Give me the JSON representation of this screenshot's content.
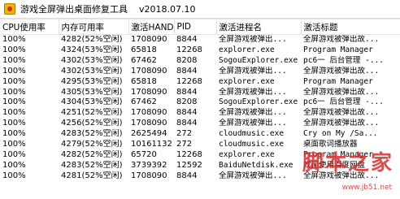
{
  "window": {
    "title": "游戏全屏弹出桌面修复工具",
    "version": "v2018.07.10"
  },
  "table": {
    "columns": [
      "CPU使用率",
      "内存可用率",
      "激活HAND",
      "PID",
      "激活进程名",
      "激活标题"
    ],
    "rows": [
      [
        "100%",
        "4282(52%空闲)",
        "1708090",
        "8844",
        "全屏游戏被弹出...",
        "全屏游戏被弹出故..."
      ],
      [
        "100%",
        "4324(53%空闲)",
        "65818",
        "12268",
        "explorer.exe",
        "Program Manager"
      ],
      [
        "100%",
        "4302(53%空闲)",
        "67462",
        "8208",
        "SogouExplorer.exe",
        "pc6一 后台管理 -..."
      ],
      [
        "100%",
        "4302(53%空闲)",
        "1708090",
        "8844",
        "全屏游戏被弹出...",
        "全屏游戏被弹出故..."
      ],
      [
        "100%",
        "4295(53%空闲)",
        "65818",
        "12268",
        "explorer.exe",
        "Program Manager"
      ],
      [
        "100%",
        "4305(53%空闲)",
        "1708090",
        "8844",
        "全屏游戏被弹出...",
        "全屏游戏被弹出故..."
      ],
      [
        "100%",
        "4304(53%空闲)",
        "67462",
        "8208",
        "SogouExplorer.exe",
        "pc6一 后台管理 -..."
      ],
      [
        "100%",
        "4251(52%空闲)",
        "1708090",
        "8844",
        "全屏游戏被弹出...",
        "全屏游戏被弹出故..."
      ],
      [
        "100%",
        "4256(52%空闲)",
        "1708090",
        "8844",
        "全屏游戏被弹出...",
        "全屏游戏被弹出故..."
      ],
      [
        "100%",
        "4283(52%空闲)",
        "2625494",
        "272",
        "cloudmusic.exe",
        "Cry on My /Sa..."
      ],
      [
        "100%",
        "4279(52%空闲)",
        "10161132",
        "272",
        "cloudmusic.exe",
        "桌面歌词播放器"
      ],
      [
        "100%",
        "4282(52%空闲)",
        "65720",
        "12268",
        "explorer.exe",
        "Program Manager"
      ],
      [
        "100%",
        "4283(52%空闲)",
        "3739392",
        "12592",
        "BaiduNetdisk.exe",
        "欢迎使用百度网盘"
      ],
      [
        "100%",
        "4281(52%空闲)",
        "1708090",
        "8844",
        "全屏游戏被弹出...",
        "全屏游戏被弹出故..."
      ]
    ]
  },
  "watermark": {
    "title": "脚本之家",
    "url": "www.jb51.net"
  }
}
